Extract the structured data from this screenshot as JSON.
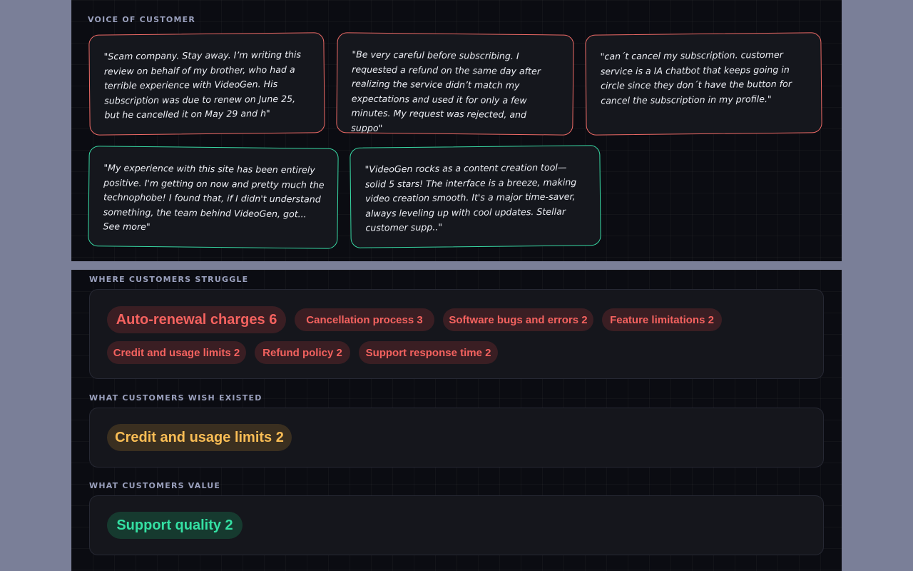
{
  "voice_of_customer": {
    "label": "VOICE OF CUSTOMER",
    "quotes": [
      {
        "text": "\"Scam company. Stay away. I’m writing this review on behalf of my brother, who had a terrible experience with VideoGen. His subscription was due to renew on June 25, but he cancelled it on May 29 and h\"",
        "sentiment": "negative"
      },
      {
        "text": "\"Be very careful before subscribing. I requested a refund on the same day after realizing the service didn’t match my expectations and used it for only a few minutes. My request was rejected, and suppo\"",
        "sentiment": "negative"
      },
      {
        "text": "\"can´t cancel my subscription. customer service is a IA chatbot that keeps going in circle since they don´t have the button for cancel the subscription in my profile.\"",
        "sentiment": "negative"
      },
      {
        "text": "\"My experience with this site has been entirely positive. I'm getting on now and pretty much the technophobe! I found that, if I didn't understand something, the team behind VideoGen, got... See more\"",
        "sentiment": "positive"
      },
      {
        "text": "\"VideoGen rocks as a content creation tool—solid 5 stars! The interface is a breeze, making video creation smooth. It's a major time-saver, always leveling up with cool updates. Stellar customer supp..\"",
        "sentiment": "positive"
      }
    ]
  },
  "struggles": {
    "label": "WHERE CUSTOMERS STRUGGLE",
    "chips": [
      {
        "text": "Auto-renewal charges 6"
      },
      {
        "text": "Cancellation process 3"
      },
      {
        "text": "Software bugs and errors 2"
      },
      {
        "text": "Feature limitations 2"
      },
      {
        "text": "Credit and usage limits 2"
      },
      {
        "text": "Refund policy 2"
      },
      {
        "text": "Support response time 2"
      }
    ]
  },
  "wishes": {
    "label": "WHAT CUSTOMERS WISH EXISTED",
    "chips": [
      {
        "text": "Credit and usage limits 2"
      }
    ]
  },
  "values": {
    "label": "WHAT CUSTOMERS VALUE",
    "chips": [
      {
        "text": "Support quality 2"
      }
    ]
  },
  "colors": {
    "negative": "#ee6a66",
    "positive": "#38d9a4",
    "struggle_chip": "#f4625f",
    "wish_chip": "#f9bd55",
    "value_chip": "#34e0a3"
  }
}
